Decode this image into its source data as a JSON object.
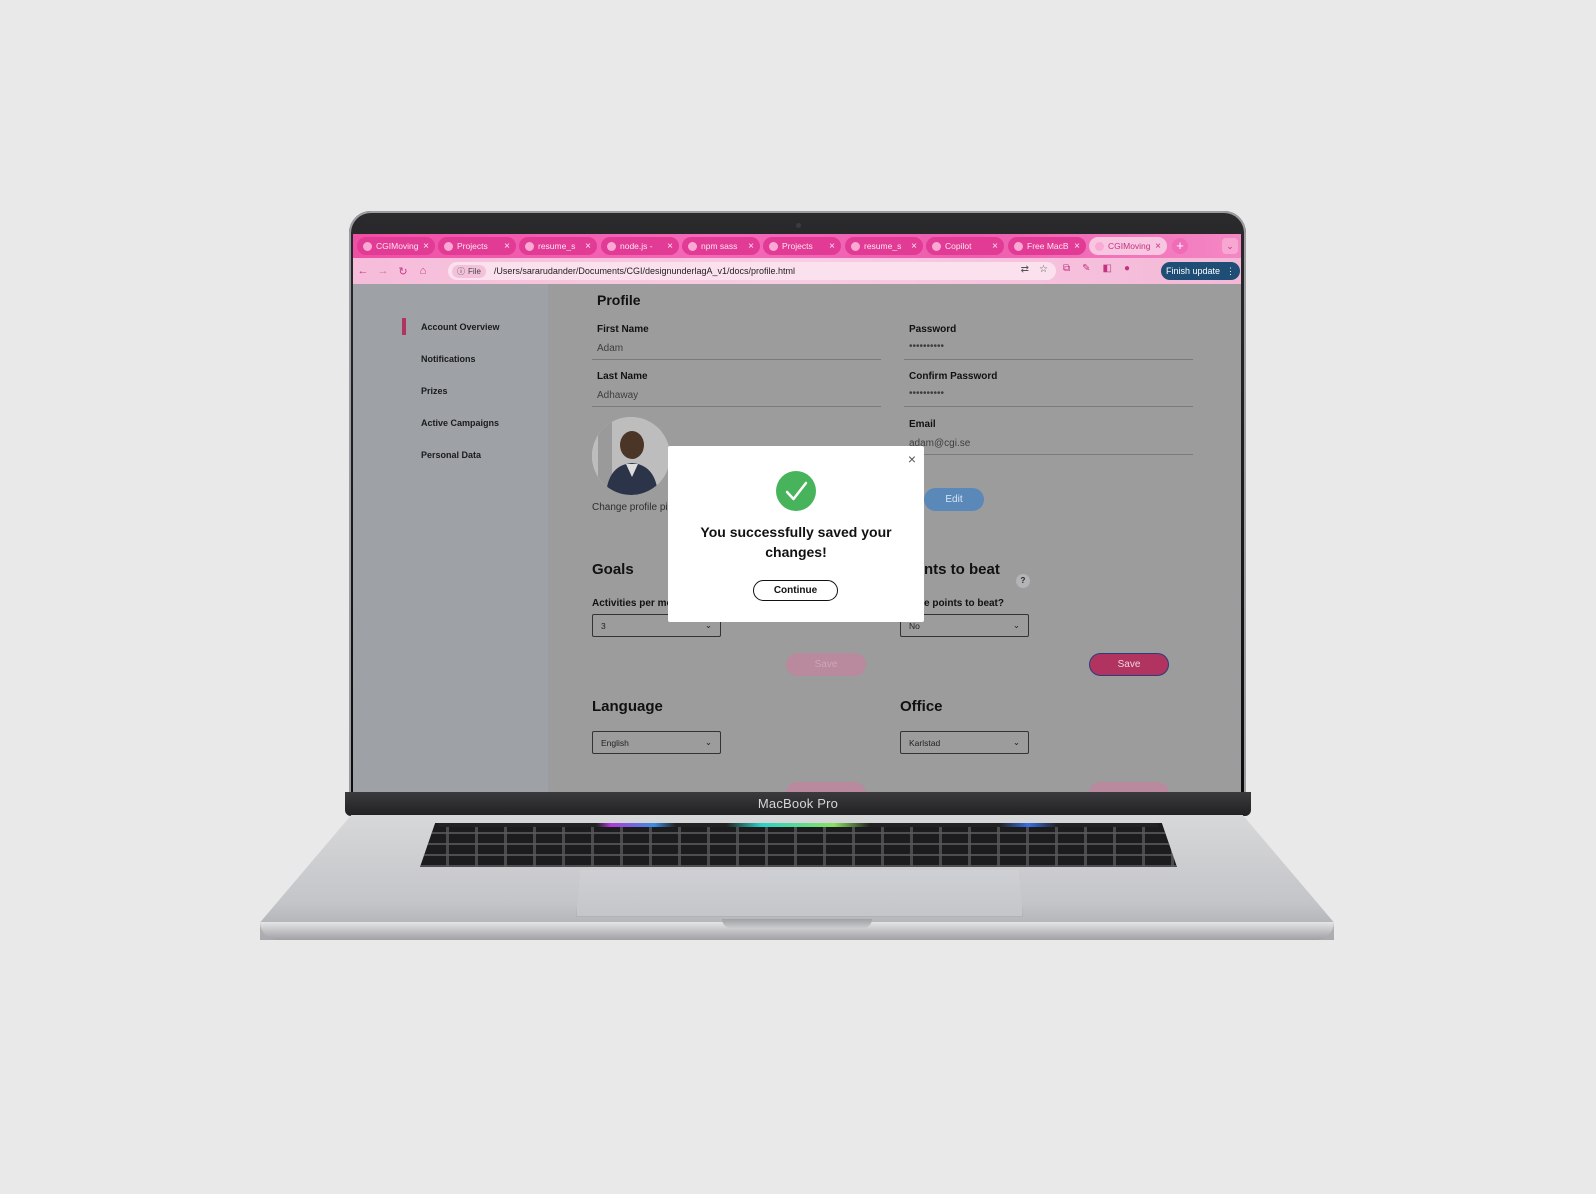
{
  "device": {
    "label": "MacBook Pro"
  },
  "tabs": [
    {
      "title": "CGIMoving"
    },
    {
      "title": "Projects"
    },
    {
      "title": "resume_s"
    },
    {
      "title": "node.js -"
    },
    {
      "title": "npm sass"
    },
    {
      "title": "Projects"
    },
    {
      "title": "resume_s"
    },
    {
      "title": "Copilot"
    },
    {
      "title": "Free MacB"
    },
    {
      "title": "CGIMoving"
    }
  ],
  "address_bar": {
    "scheme_chip": "File",
    "url": "/Users/sararudander/Documents/CGI/designunderlagA_v1/docs/profile.html"
  },
  "finish_update": "Finish update",
  "sidebar": {
    "items": [
      {
        "label": "Account Overview"
      },
      {
        "label": "Notifications"
      },
      {
        "label": "Prizes"
      },
      {
        "label": "Active Campaigns"
      },
      {
        "label": "Personal Data"
      }
    ]
  },
  "profile": {
    "heading": "Profile",
    "first_name_label": "First Name",
    "first_name": "Adam",
    "last_name_label": "Last Name",
    "last_name": "Adhaway",
    "password_label": "Password",
    "password": "••••••••••",
    "confirm_label": "Confirm Password",
    "confirm": "••••••••••",
    "email_label": "Email",
    "email": "adam@cgi.se",
    "change_picture": "Change profile pi",
    "edit_button": "Edit"
  },
  "goals": {
    "heading": "Goals",
    "activities_label": "Activities per mo",
    "activities_value": "3",
    "save_label": "Save"
  },
  "points": {
    "heading": "nts to beat",
    "question": "e points to beat?",
    "value": "No",
    "help": "?",
    "save_label": "Save"
  },
  "language": {
    "heading": "Language",
    "value": "English"
  },
  "office": {
    "heading": "Office",
    "value": "Karlstad"
  },
  "modal": {
    "message": "You successfully saved your changes!",
    "continue_label": "Continue",
    "close": "×"
  },
  "colors": {
    "accent_pink": "#b0345f",
    "edit_blue": "#5a88b8",
    "success_green": "#47b35b",
    "chrome_pink": "#ef4fa4"
  }
}
